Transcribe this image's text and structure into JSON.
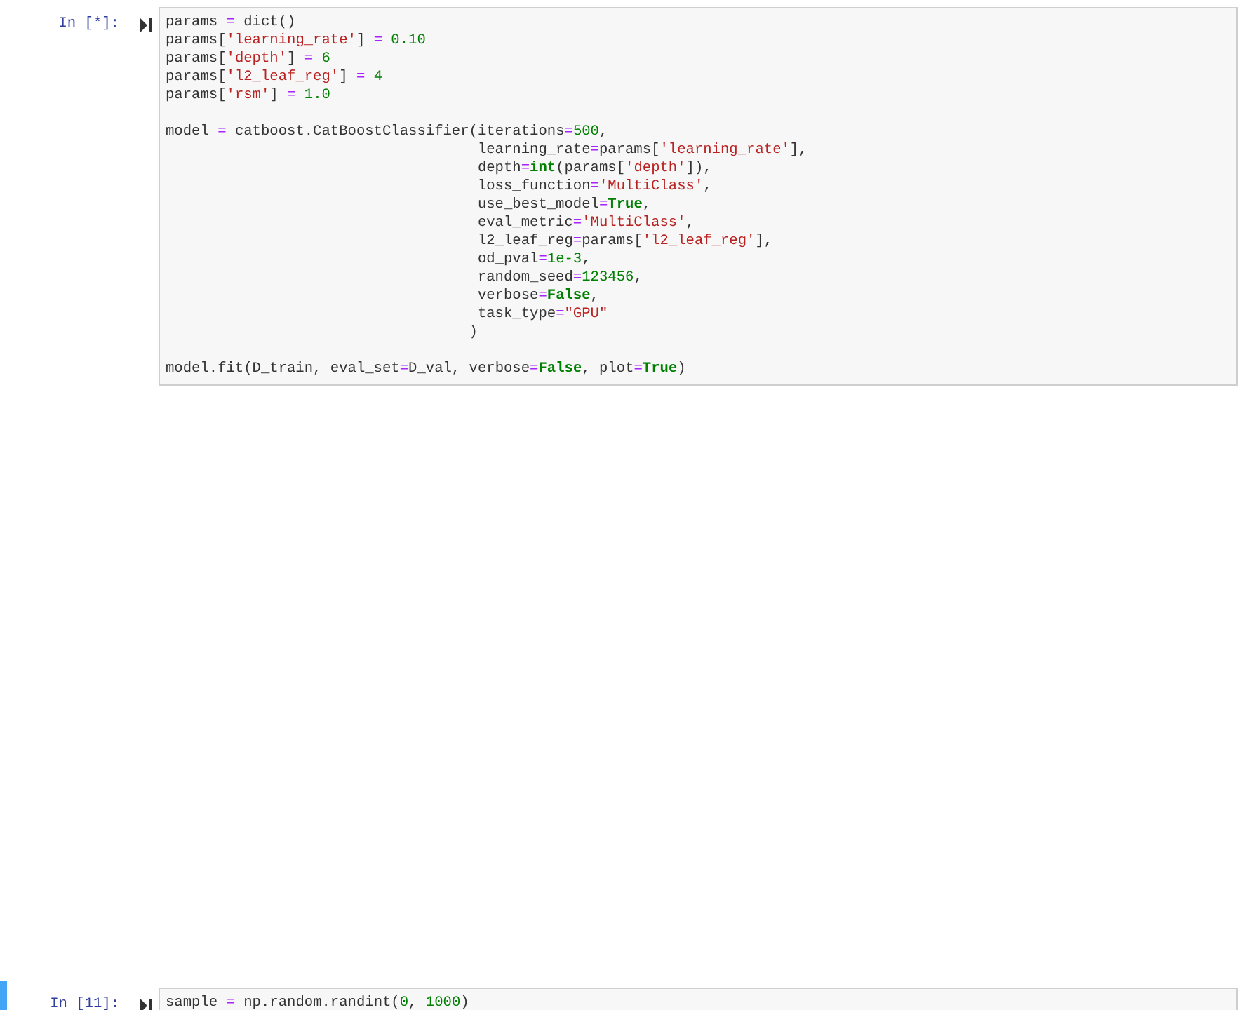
{
  "cells": [
    {
      "prompt": "In [*]:",
      "selected": false,
      "blocks": [
        [
          [
            {
              "text": "params ",
              "kind": "n"
            },
            {
              "text": "=",
              "kind": "o"
            },
            {
              "text": " dict()",
              "kind": "n"
            }
          ],
          [
            {
              "text": "params[",
              "kind": "n"
            },
            {
              "text": "'learning_rate'",
              "kind": "s"
            },
            {
              "text": "] ",
              "kind": "n"
            },
            {
              "text": "= ",
              "kind": "o"
            },
            {
              "text": "0.10",
              "kind": "m"
            }
          ],
          [
            {
              "text": "params[",
              "kind": "n"
            },
            {
              "text": "'depth'",
              "kind": "s"
            },
            {
              "text": "] ",
              "kind": "n"
            },
            {
              "text": "= ",
              "kind": "o"
            },
            {
              "text": "6",
              "kind": "m"
            }
          ],
          [
            {
              "text": "params[",
              "kind": "n"
            },
            {
              "text": "'l2_leaf_reg'",
              "kind": "s"
            },
            {
              "text": "] ",
              "kind": "n"
            },
            {
              "text": "= ",
              "kind": "o"
            },
            {
              "text": "4",
              "kind": "m"
            }
          ],
          [
            {
              "text": "params[",
              "kind": "n"
            },
            {
              "text": "'rsm'",
              "kind": "s"
            },
            {
              "text": "] ",
              "kind": "n"
            },
            {
              "text": "= ",
              "kind": "o"
            },
            {
              "text": "1.0",
              "kind": "m"
            }
          ]
        ],
        [
          [
            {
              "text": "model ",
              "kind": "n"
            },
            {
              "text": "=",
              "kind": "o"
            },
            {
              "text": " catboost.CatBoostClassifier(iterations",
              "kind": "n"
            },
            {
              "text": "=",
              "kind": "o"
            },
            {
              "text": "500",
              "kind": "m"
            },
            {
              "text": ",",
              "kind": "n"
            }
          ],
          [
            {
              "text": "                                    learning_rate",
              "kind": "n"
            },
            {
              "text": "=",
              "kind": "o"
            },
            {
              "text": "params[",
              "kind": "n"
            },
            {
              "text": "'learning_rate'",
              "kind": "s"
            },
            {
              "text": "],",
              "kind": "n"
            }
          ],
          [
            {
              "text": "                                    depth",
              "kind": "n"
            },
            {
              "text": "=",
              "kind": "o"
            },
            {
              "text": "int",
              "kind": "k"
            },
            {
              "text": "(params[",
              "kind": "n"
            },
            {
              "text": "'depth'",
              "kind": "s"
            },
            {
              "text": "]),",
              "kind": "n"
            }
          ],
          [
            {
              "text": "                                    loss_function",
              "kind": "n"
            },
            {
              "text": "=",
              "kind": "o"
            },
            {
              "text": "'MultiClass'",
              "kind": "s"
            },
            {
              "text": ",",
              "kind": "n"
            }
          ],
          [
            {
              "text": "                                    use_best_model",
              "kind": "n"
            },
            {
              "text": "=",
              "kind": "o"
            },
            {
              "text": "True",
              "kind": "k"
            },
            {
              "text": ",",
              "kind": "n"
            }
          ],
          [
            {
              "text": "                                    eval_metric",
              "kind": "n"
            },
            {
              "text": "=",
              "kind": "o"
            },
            {
              "text": "'MultiClass'",
              "kind": "s"
            },
            {
              "text": ",",
              "kind": "n"
            }
          ],
          [
            {
              "text": "                                    l2_leaf_reg",
              "kind": "n"
            },
            {
              "text": "=",
              "kind": "o"
            },
            {
              "text": "params[",
              "kind": "n"
            },
            {
              "text": "'l2_leaf_reg'",
              "kind": "s"
            },
            {
              "text": "],",
              "kind": "n"
            }
          ],
          [
            {
              "text": "                                    od_pval",
              "kind": "n"
            },
            {
              "text": "=",
              "kind": "o"
            },
            {
              "text": "1e-3",
              "kind": "m"
            },
            {
              "text": ",",
              "kind": "n"
            }
          ],
          [
            {
              "text": "                                    random_seed",
              "kind": "n"
            },
            {
              "text": "=",
              "kind": "o"
            },
            {
              "text": "123456",
              "kind": "m"
            },
            {
              "text": ",",
              "kind": "n"
            }
          ],
          [
            {
              "text": "                                    verbose",
              "kind": "n"
            },
            {
              "text": "=",
              "kind": "o"
            },
            {
              "text": "False",
              "kind": "k"
            },
            {
              "text": ",",
              "kind": "n"
            }
          ],
          [
            {
              "text": "                                    task_type",
              "kind": "n"
            },
            {
              "text": "=",
              "kind": "o"
            },
            {
              "text": "\"GPU\"",
              "kind": "s"
            }
          ],
          [
            {
              "text": "                                   )",
              "kind": "n"
            }
          ]
        ],
        [
          [
            {
              "text": "model.fit(D_train, eval_set",
              "kind": "n"
            },
            {
              "text": "=",
              "kind": "o"
            },
            {
              "text": "D_val, verbose",
              "kind": "n"
            },
            {
              "text": "=",
              "kind": "o"
            },
            {
              "text": "False",
              "kind": "k"
            },
            {
              "text": ", plot",
              "kind": "n"
            },
            {
              "text": "=",
              "kind": "o"
            },
            {
              "text": "True",
              "kind": "k"
            },
            {
              "text": ")",
              "kind": "n"
            }
          ]
        ]
      ]
    },
    {
      "prompt": "In [11]:",
      "selected": true,
      "blocks": [
        [
          [
            {
              "text": "sample ",
              "kind": "n"
            },
            {
              "text": "=",
              "kind": "o"
            },
            {
              "text": " np.random.randint(",
              "kind": "n"
            },
            {
              "text": "0",
              "kind": "m"
            },
            {
              "text": ", ",
              "kind": "n"
            },
            {
              "text": "1000",
              "kind": "m"
            },
            {
              "text": ")",
              "kind": "n"
            }
          ]
        ]
      ]
    }
  ]
}
